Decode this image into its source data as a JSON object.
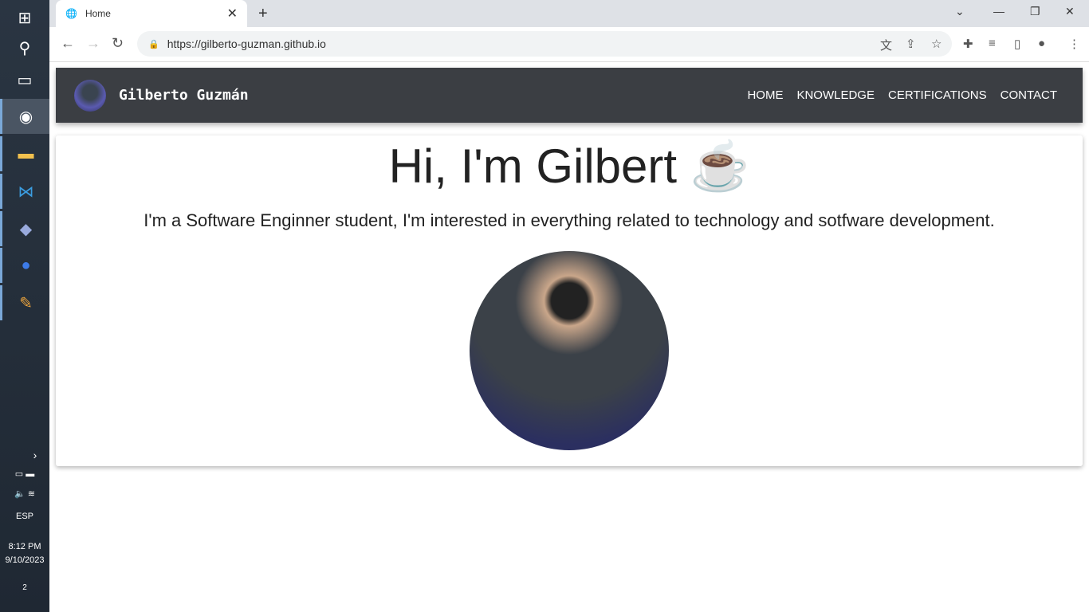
{
  "taskbar": {
    "lang": "ESP",
    "time": "8:12 PM",
    "date": "9/10/2023",
    "notifications": "2"
  },
  "browser": {
    "tab_title": "Home",
    "url": "https://gilberto-guzman.github.io"
  },
  "site": {
    "brand": "Gilberto Guzmán",
    "nav": [
      "HOME",
      "KNOWLEDGE",
      "CERTIFICATIONS",
      "CONTACT"
    ],
    "heading": "Hi, I'm Gilbert ☕",
    "intro": "I'm a Software Enginner student, I'm interested in everything related to technology and sotfware development."
  }
}
